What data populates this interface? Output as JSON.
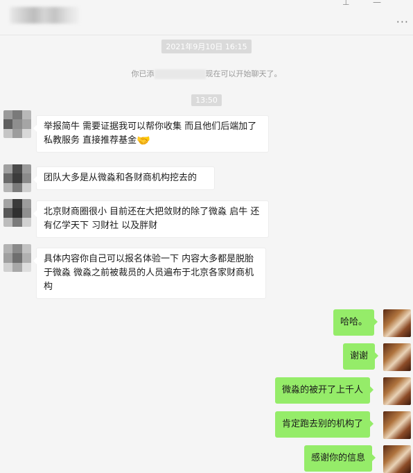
{
  "chat": {
    "time_1": "2021年9月10日 16:15",
    "system_before": "你已添",
    "system_after": "现在可以开始聊天了。",
    "time_2": "13:50"
  },
  "messages_left": [
    {
      "text": "举报简牛 需要证据我可以帮你收集 而且他们后端加了私教服务 直接推荐基金",
      "emoji": "🤝"
    },
    {
      "text": "团队大多是从微淼和各财商机构挖去的"
    },
    {
      "text": "北京财商圈很小 目前还在大把敛财的除了微淼 启牛 还有亿学天下 习财社 以及胖财"
    },
    {
      "text": "具体内容你自己可以报名体验一下 内容大多都是脱胎于微淼 微淼之前被裁员的人员遍布于北京各家财商机构"
    }
  ],
  "messages_right": [
    {
      "text": "哈哈。"
    },
    {
      "text": "谢谢"
    },
    {
      "text": "微淼的被开了上千人"
    },
    {
      "text": "肯定跑去别的机构了"
    },
    {
      "text": "感谢你的信息"
    }
  ],
  "icons": {
    "pin": "pin-icon",
    "minimize": "minimize-icon",
    "more": "more-icon"
  }
}
